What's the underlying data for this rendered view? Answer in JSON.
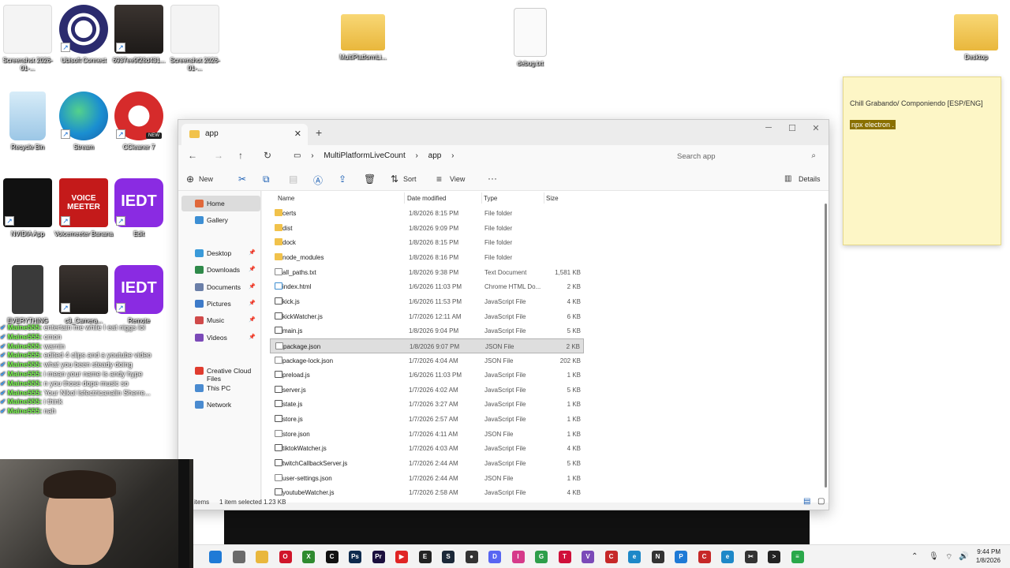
{
  "desktop": {
    "icons": [
      {
        "label": "Screenshot 2026-01-...",
        "icon": "screenshot-thumbnail"
      },
      {
        "label": "Ubisoft Connect",
        "icon": "ubisoft-connect-icon"
      },
      {
        "label": "6937ee9f28d431...",
        "icon": "photo-thumbnail"
      },
      {
        "label": "Screenshot 2026-01-...",
        "icon": "screenshot-thumbnail"
      },
      {
        "label": "MultiPlatformLi...",
        "icon": "folder-icon"
      },
      {
        "label": "debug.txt",
        "icon": "text-file-icon"
      },
      {
        "label": "Desktop",
        "icon": "folder-icon"
      },
      {
        "label": "Recycle Bin",
        "icon": "recycle-bin-icon"
      },
      {
        "label": "Stream",
        "icon": "edge-icon"
      },
      {
        "label": "CCleaner 7",
        "icon": "ccleaner-icon",
        "badge": "NEW"
      },
      {
        "label": "NVIDIA App",
        "icon": "nvidia-icon"
      },
      {
        "label": "Voicemeeter Banana",
        "icon": "voicemeeter-icon",
        "text": "VOICE MEETER"
      },
      {
        "label": "Edit",
        "icon": "iedt-icon",
        "text": "IEDT"
      },
      {
        "label": "EVERYTHING",
        "icon": "chip-icon"
      },
      {
        "label": "c3_Camera...",
        "icon": "photo-thumbnail"
      },
      {
        "label": "Remote",
        "icon": "iedt-icon",
        "text": "IEDT"
      }
    ]
  },
  "sticky": {
    "line1": "Chill Grabando/ Componiendo [ESP/ENG]",
    "line2": "npx electron ."
  },
  "chat": {
    "rows": [
      {
        "name": "Maine555",
        "msg": "entertain me while I eat niggs lol"
      },
      {
        "name": "Maine555",
        "msg": "cmon"
      },
      {
        "name": "Maine555",
        "msg": "warnin"
      },
      {
        "name": "Maine555",
        "msg": "edited 4 clips and a youtube video"
      },
      {
        "name": "Maine555",
        "msg": "what you been steady doing"
      },
      {
        "name": "Maine555",
        "msg": "i mean your name is andy hype"
      },
      {
        "name": "Maine555",
        "msg": "n you those dope music so"
      },
      {
        "name": "Maine555",
        "msg": "Your Nikol Isfectricanalin Sherre..."
      },
      {
        "name": "Maine555",
        "msg": "i think"
      },
      {
        "name": "Maine555",
        "msg": "nah"
      }
    ]
  },
  "explorer": {
    "tab_title": "app",
    "breadcrumb": [
      "MultiPlatformLiveCount",
      "app"
    ],
    "search_placeholder": "Search app",
    "toolbar": {
      "new": "New",
      "sort": "Sort",
      "view": "View",
      "more": "···",
      "details": "Details"
    },
    "nav": [
      {
        "label": "Home",
        "icon": "home-icon",
        "color": "#e0683a",
        "selected": true
      },
      {
        "label": "Gallery",
        "icon": "gallery-icon",
        "color": "#3d8fd4"
      },
      {
        "label": "Desktop",
        "icon": "desktop-icon",
        "color": "#3a9ad9",
        "pinned": true
      },
      {
        "label": "Downloads",
        "icon": "download-icon",
        "color": "#2f8a4a",
        "pinned": true
      },
      {
        "label": "Documents",
        "icon": "documents-icon",
        "color": "#6b7fa8",
        "pinned": true
      },
      {
        "label": "Pictures",
        "icon": "pictures-icon",
        "color": "#3e7bc9",
        "pinned": true
      },
      {
        "label": "Music",
        "icon": "music-icon",
        "color": "#d04a4a",
        "pinned": true
      },
      {
        "label": "Videos",
        "icon": "videos-icon",
        "color": "#7b4ab8",
        "pinned": true
      },
      {
        "label": "Creative Cloud Files",
        "icon": "creative-cloud-icon",
        "color": "#e03c2f"
      },
      {
        "label": "This PC",
        "icon": "pc-icon",
        "color": "#4a8bd0"
      },
      {
        "label": "Network",
        "icon": "network-icon",
        "color": "#4a8bd0"
      }
    ],
    "columns": [
      "Name",
      "Date modified",
      "Type",
      "Size"
    ],
    "files": [
      {
        "name": "certs",
        "date": "1/8/2026 8:15 PM",
        "type": "File folder",
        "size": "",
        "kind": "folder"
      },
      {
        "name": "dist",
        "date": "1/8/2026 9:09 PM",
        "type": "File folder",
        "size": "",
        "kind": "folder"
      },
      {
        "name": "dock",
        "date": "1/8/2026 8:15 PM",
        "type": "File folder",
        "size": "",
        "kind": "folder"
      },
      {
        "name": "node_modules",
        "date": "1/8/2026 8:16 PM",
        "type": "File folder",
        "size": "",
        "kind": "folder"
      },
      {
        "name": "all_paths.txt",
        "date": "1/8/2026 9:38 PM",
        "type": "Text Document",
        "size": "1,581 KB",
        "kind": "file"
      },
      {
        "name": "index.html",
        "date": "1/6/2026 11:03 PM",
        "type": "Chrome HTML Do...",
        "size": "2 KB",
        "kind": "html"
      },
      {
        "name": "kick.js",
        "date": "1/6/2026 11:53 PM",
        "type": "JavaScript File",
        "size": "4 KB",
        "kind": "js"
      },
      {
        "name": "kickWatcher.js",
        "date": "1/7/2026 12:11 AM",
        "type": "JavaScript File",
        "size": "6 KB",
        "kind": "js"
      },
      {
        "name": "main.js",
        "date": "1/8/2026 9:04 PM",
        "type": "JavaScript File",
        "size": "5 KB",
        "kind": "js"
      },
      {
        "name": "package.json",
        "date": "1/8/2026 9:07 PM",
        "type": "JSON File",
        "size": "2 KB",
        "kind": "file",
        "selected": true
      },
      {
        "name": "package-lock.json",
        "date": "1/7/2026 4:04 AM",
        "type": "JSON File",
        "size": "202 KB",
        "kind": "file"
      },
      {
        "name": "preload.js",
        "date": "1/6/2026 11:03 PM",
        "type": "JavaScript File",
        "size": "1 KB",
        "kind": "js"
      },
      {
        "name": "server.js",
        "date": "1/7/2026 4:02 AM",
        "type": "JavaScript File",
        "size": "5 KB",
        "kind": "js"
      },
      {
        "name": "state.js",
        "date": "1/7/2026 3:27 AM",
        "type": "JavaScript File",
        "size": "1 KB",
        "kind": "js"
      },
      {
        "name": "store.js",
        "date": "1/7/2026 2:57 AM",
        "type": "JavaScript File",
        "size": "1 KB",
        "kind": "js"
      },
      {
        "name": "store.json",
        "date": "1/7/2026 4:11 AM",
        "type": "JSON File",
        "size": "1 KB",
        "kind": "file"
      },
      {
        "name": "tiktokWatcher.js",
        "date": "1/7/2026 4:03 AM",
        "type": "JavaScript File",
        "size": "4 KB",
        "kind": "js"
      },
      {
        "name": "twitchCallbackServer.js",
        "date": "1/7/2026 2:44 AM",
        "type": "JavaScript File",
        "size": "5 KB",
        "kind": "js"
      },
      {
        "name": "user-settings.json",
        "date": "1/7/2026 2:44 AM",
        "type": "JSON File",
        "size": "1 KB",
        "kind": "file"
      },
      {
        "name": "youtubeWatcher.js",
        "date": "1/7/2026 2:58 AM",
        "type": "JavaScript File",
        "size": "4 KB",
        "kind": "js"
      }
    ],
    "status": {
      "items": "items",
      "selected": "1 item selected",
      "size": "1.23 KB"
    }
  },
  "taskbar": {
    "apps": [
      {
        "name": "windows-start-icon",
        "color": "#1f7ad6",
        "text": ""
      },
      {
        "name": "file-manager-icon",
        "color": "#6a6a6a",
        "text": ""
      },
      {
        "name": "file-explorer-icon",
        "color": "#e9b73c",
        "text": ""
      },
      {
        "name": "opera-icon",
        "color": "#d0152a",
        "text": "O"
      },
      {
        "name": "xbox-icon",
        "color": "#2f8a2f",
        "text": "X"
      },
      {
        "name": "capcut-icon",
        "color": "#111111",
        "text": "C"
      },
      {
        "name": "photoshop-icon",
        "color": "#0d2a4d",
        "text": "Ps"
      },
      {
        "name": "premiere-icon",
        "color": "#1b0f3d",
        "text": "Pr"
      },
      {
        "name": "youtube-icon",
        "color": "#e02424",
        "text": "▶"
      },
      {
        "name": "epic-games-icon",
        "color": "#222222",
        "text": "E"
      },
      {
        "name": "steam-icon",
        "color": "#1b2838",
        "text": "S"
      },
      {
        "name": "obs-icon",
        "color": "#333333",
        "text": "●"
      },
      {
        "name": "discord-icon",
        "color": "#5865f2",
        "text": "D"
      },
      {
        "name": "instagram-icon",
        "color": "#d63a8a",
        "text": "I"
      },
      {
        "name": "chrome-icon",
        "color": "#2e9e4a",
        "text": "G"
      },
      {
        "name": "tiktok-icon",
        "color": "#d0103a",
        "text": "T"
      },
      {
        "name": "visual-studio-icon",
        "color": "#7b4ab8",
        "text": "V"
      },
      {
        "name": "ccleaner-icon",
        "color": "#c62828",
        "text": "C"
      },
      {
        "name": "edge-icon",
        "color": "#1e88c8",
        "text": "e"
      },
      {
        "name": "notepad-icon",
        "color": "#333333",
        "text": "N"
      },
      {
        "name": "photos-icon",
        "color": "#1e7ad6",
        "text": "P"
      },
      {
        "name": "ccleaner-icon-2",
        "color": "#c62828",
        "text": "C"
      },
      {
        "name": "edge-dev-icon",
        "color": "#1e88c8",
        "text": "e"
      },
      {
        "name": "snipping-icon",
        "color": "#333333",
        "text": "✂"
      },
      {
        "name": "terminal-icon",
        "color": "#222222",
        "text": ">"
      },
      {
        "name": "notes-icon",
        "color": "#2aa84a",
        "text": "≡"
      }
    ],
    "time": "9:44 PM",
    "date": "1/8/2026"
  }
}
